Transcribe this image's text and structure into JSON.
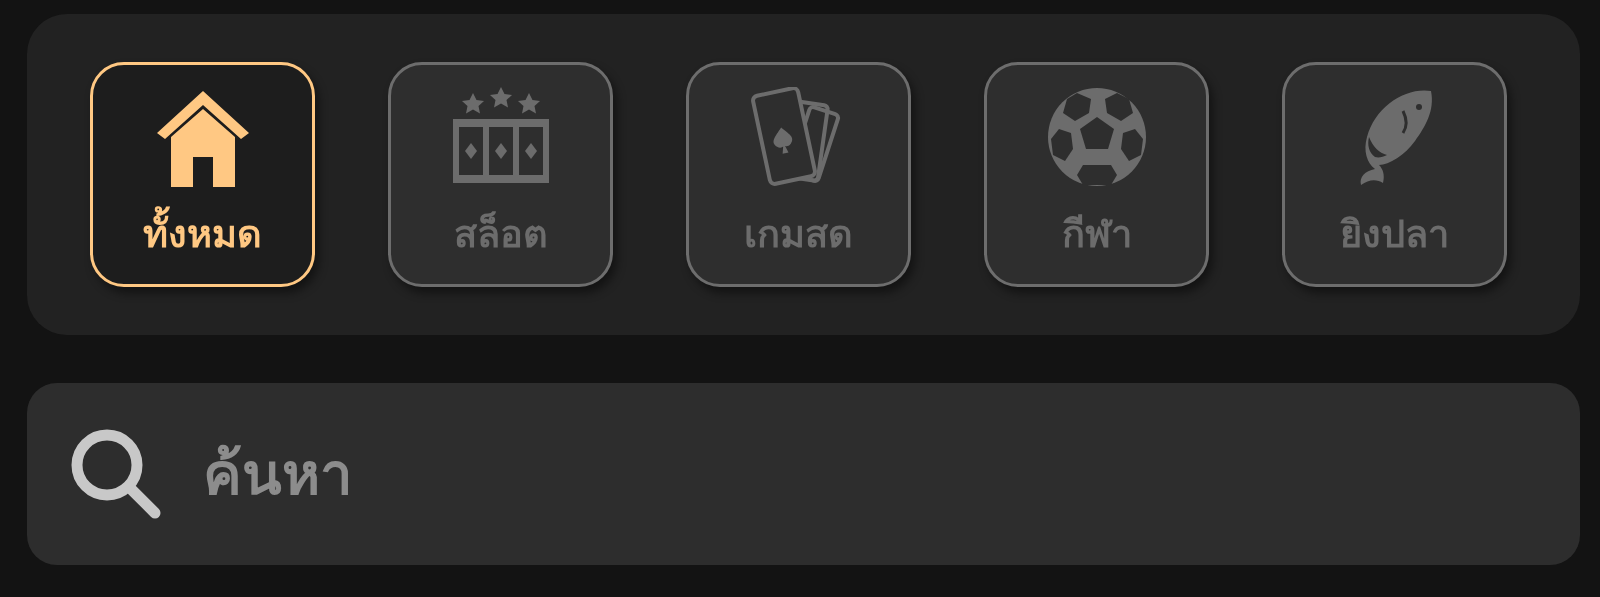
{
  "categories": [
    {
      "kind": "home",
      "label": "ทั้งหมด",
      "selected": true
    },
    {
      "kind": "slot",
      "label": "สล็อต",
      "selected": false
    },
    {
      "kind": "cards",
      "label": "เกมสด",
      "selected": false
    },
    {
      "kind": "ball",
      "label": "กีฬา",
      "selected": false
    },
    {
      "kind": "fish",
      "label": "ยิงปลา",
      "selected": false
    }
  ],
  "search": {
    "placeholder": "ค้นหา"
  }
}
